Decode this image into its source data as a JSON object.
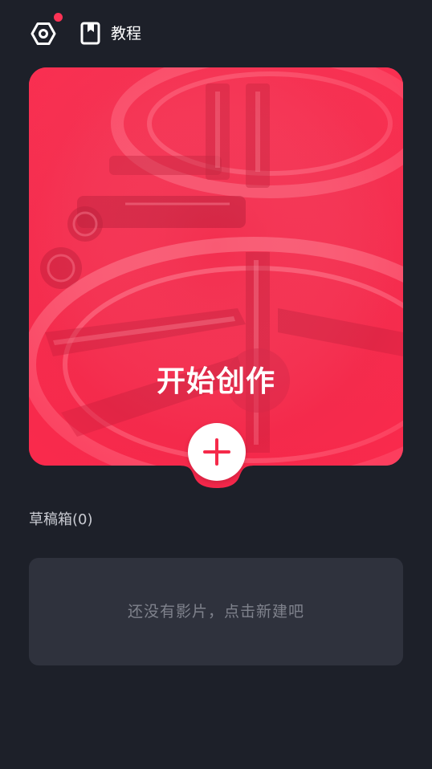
{
  "header": {
    "settings_icon": "hexagon-gear-icon",
    "notification_dot_color": "#fc3355",
    "tutorial_icon": "bookmark-book-icon",
    "tutorial_label": "教程"
  },
  "hero": {
    "title": "开始创作",
    "accent_color": "#f52a4a",
    "background_image": "film-reel-photo",
    "add_icon": "plus-icon"
  },
  "drafts": {
    "title": "草稿箱(0)",
    "empty_message": "还没有影片，点击新建吧"
  },
  "colors": {
    "background": "#1d2029",
    "card": "#2f323d"
  }
}
